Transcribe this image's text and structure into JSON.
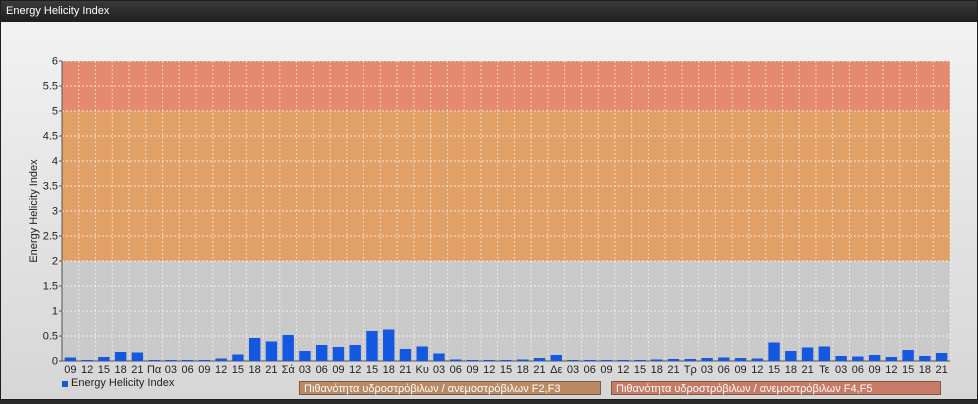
{
  "window": {
    "title": "Energy Helicity Index"
  },
  "legend": {
    "series": "Energy Helicity Index",
    "band1": "Πιθανότητα υδροστρόβιλων / ανεμοστρόβιλων F2,F3",
    "band2": "Πιθανότητα υδροστρόβιλων / ανεμοστρόβιλων F4,F5"
  },
  "colors": {
    "bar": "#1457e0",
    "band_low": "#c9c9c9",
    "band_mid": "#e0a066",
    "band_high": "#e58a6e",
    "legend_band1": "#b98a63",
    "legend_band2": "#c97a66"
  },
  "chart_data": {
    "type": "bar",
    "title": "",
    "xlabel": "",
    "ylabel": "Energy Helicity Index",
    "ylim": [
      0,
      6
    ],
    "yticks": [
      "0",
      "0.5",
      "1",
      "1.5",
      "2",
      "2.5",
      "3",
      "3.5",
      "4",
      "4.5",
      "5",
      "5.5",
      "6"
    ],
    "grid": true,
    "legend_position": "bottom-left",
    "bands": [
      {
        "from": 2,
        "to": 5,
        "name": "Πιθανότητα υδροστρόβιλων / ανεμοστρόβιλων F2,F3"
      },
      {
        "from": 5,
        "to": 6,
        "name": "Πιθανότητα υδροστρόβιλων / ανεμοστρόβιλων F4,F5"
      }
    ],
    "categories": [
      "09",
      "12",
      "15",
      "18",
      "21",
      "Πα",
      "03",
      "06",
      "09",
      "12",
      "15",
      "18",
      "21",
      "Σά",
      "03",
      "06",
      "09",
      "12",
      "15",
      "18",
      "21",
      "Κυ",
      "03",
      "06",
      "09",
      "12",
      "15",
      "18",
      "21",
      "Δε",
      "03",
      "06",
      "09",
      "12",
      "15",
      "18",
      "21",
      "Τρ",
      "03",
      "06",
      "09",
      "12",
      "15",
      "18",
      "21",
      "Τε",
      "03",
      "06",
      "09",
      "12",
      "15",
      "18",
      "21"
    ],
    "series": [
      {
        "name": "Energy Helicity Index",
        "values": [
          0.07,
          0.02,
          0.08,
          0.18,
          0.17,
          0.02,
          0.02,
          0.02,
          0.02,
          0.05,
          0.13,
          0.46,
          0.39,
          0.52,
          0.2,
          0.32,
          0.28,
          0.32,
          0.6,
          0.63,
          0.24,
          0.29,
          0.15,
          0.03,
          0.02,
          0.02,
          0.02,
          0.03,
          0.06,
          0.12,
          0.02,
          0.02,
          0.02,
          0.02,
          0.02,
          0.03,
          0.04,
          0.04,
          0.06,
          0.07,
          0.06,
          0.05,
          0.37,
          0.2,
          0.27,
          0.29,
          0.1,
          0.09,
          0.12,
          0.08,
          0.22,
          0.1,
          0.16
        ]
      }
    ]
  }
}
